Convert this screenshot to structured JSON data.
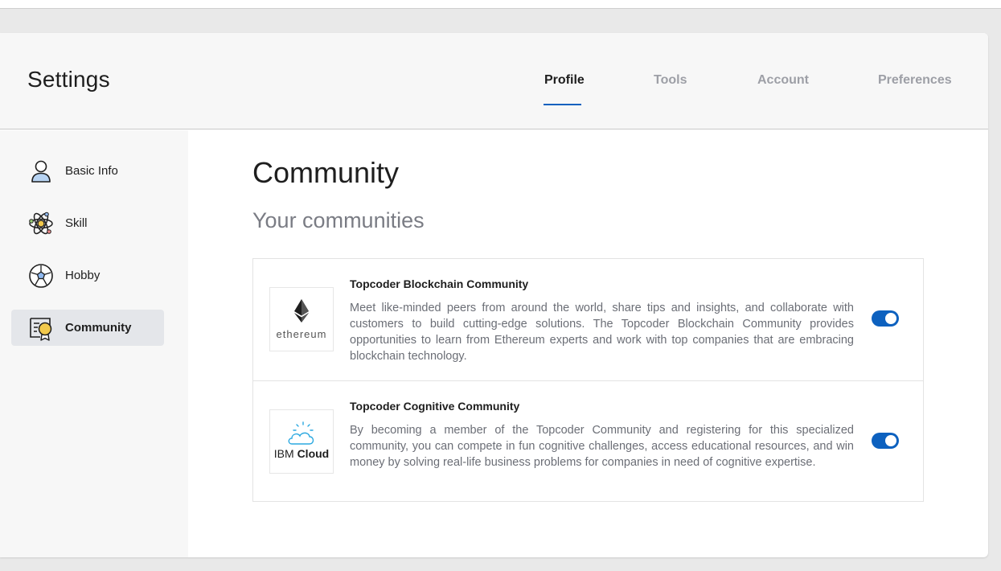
{
  "header": {
    "title": "Settings",
    "tabs": [
      {
        "label": "Profile",
        "active": true
      },
      {
        "label": "Tools",
        "active": false
      },
      {
        "label": "Account",
        "active": false
      },
      {
        "label": "Preferences",
        "active": false
      }
    ]
  },
  "sidebar": {
    "items": [
      {
        "label": "Basic Info",
        "icon": "user-icon",
        "active": false
      },
      {
        "label": "Skill",
        "icon": "atom-icon",
        "active": false
      },
      {
        "label": "Hobby",
        "icon": "soccer-ball-icon",
        "active": false
      },
      {
        "label": "Community",
        "icon": "certificate-icon",
        "active": true
      }
    ]
  },
  "main": {
    "title": "Community",
    "section_title": "Your communities",
    "communities": [
      {
        "logo": "ethereum-logo",
        "logo_text": "ethereum",
        "name": "Topcoder Blockchain Community",
        "description": "Meet like-minded peers from around the world, share tips and insights, and collaborate with customers to build cutting-edge solutions. The Topcoder Blockchain Community provides opportunities to learn from Ethereum experts and work with top companies that are embracing blockchain technology.",
        "enabled": true
      },
      {
        "logo": "ibm-cloud-logo",
        "logo_text_regular": "IBM",
        "logo_text_bold": "Cloud",
        "name": "Topcoder Cognitive Community",
        "description": "By becoming a member of the Topcoder Community and registering for this specialized community, you can compete in fun cognitive challenges, access educational resources, and win money by solving real-life business problems for companies in need of cognitive expertise.",
        "enabled": true
      }
    ]
  },
  "colors": {
    "accent": "#0d61bf",
    "muted_text": "#9d9fa6",
    "description_text": "#6b6e76"
  }
}
